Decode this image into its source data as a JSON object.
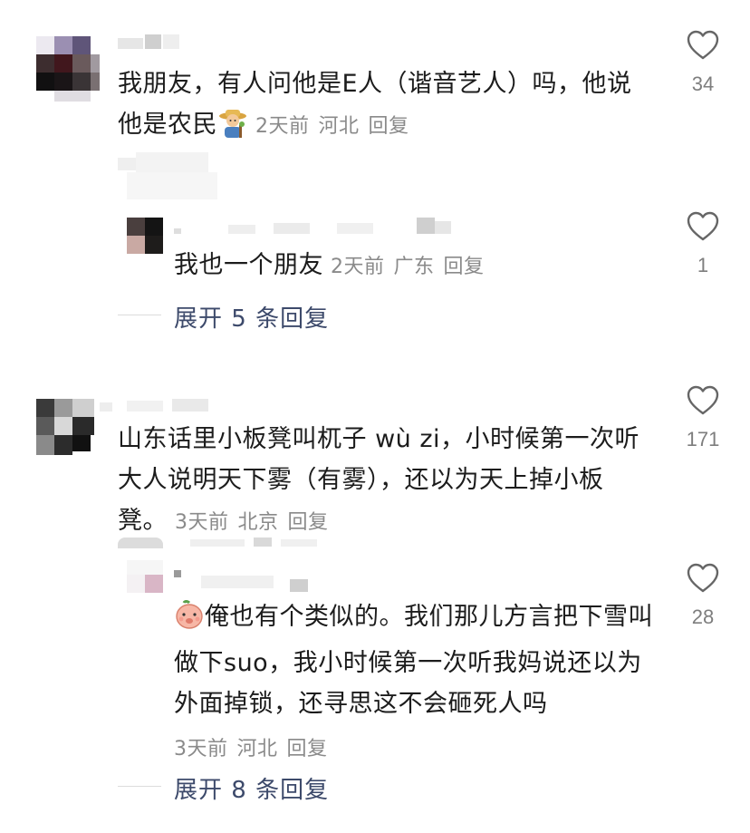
{
  "comments": [
    {
      "text": "我朋友，有人问他是E人（谐音艺人）吗，他说他是农民",
      "emoji": "farmer-emoji",
      "time": "2天前",
      "location": "河北",
      "reply_label": "回复",
      "likes": "34"
    },
    {
      "text": "我也一个朋友",
      "time": "2天前",
      "location": "广东",
      "reply_label": "回复",
      "likes": "1"
    },
    {
      "text": "山东话里小板凳叫杌子 wù zi，小时候第一次听大人说明天下雾（有雾），还以为天上掉小板凳。",
      "time": "3天前",
      "location": "北京",
      "reply_label": "回复",
      "likes": "171"
    },
    {
      "text": "俺也有个类似的。我们那儿方言把下雪叫做下suo，我小时候第一次听我妈说还以为外面掉锁，还寻思这不会砸死人吗",
      "emoji": "peach-face-emoji",
      "time": "3天前",
      "location": "河北",
      "reply_label": "回复",
      "likes": "28"
    }
  ],
  "expand": [
    {
      "label": "展开 5 条回复"
    },
    {
      "label": "展开 8 条回复"
    }
  ],
  "colors": {
    "accent": "#3d4a6b",
    "meta": "#8a8a8a",
    "heart_stroke": "#666666"
  }
}
